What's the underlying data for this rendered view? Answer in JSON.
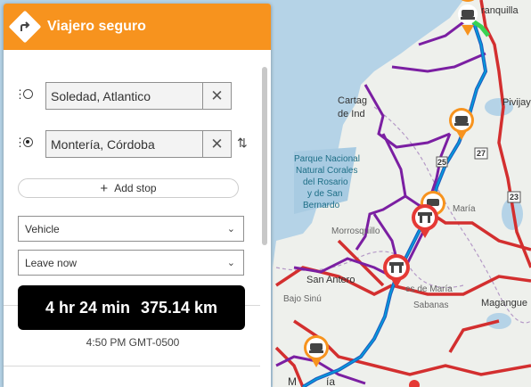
{
  "app": {
    "title": "Viajero seguro"
  },
  "route": {
    "origin": "Soledad, Atlantico",
    "destination": "Montería, Córdoba",
    "add_stop_label": "Add stop",
    "vehicle_select": "Vehicle",
    "departure_select": "Leave now"
  },
  "summary": {
    "duration": "4 hr 24 min",
    "distance": "375.14 km",
    "eta": "4:50 PM GMT-0500"
  },
  "map": {
    "labels": {
      "cartagena_1": "Cartag",
      "cartagena_2": "de Ind",
      "park_1": "Parque Nacional",
      "park_2": "Natural Corales",
      "park_3": "del Rosario",
      "park_4": "y de San",
      "park_5": "Bernardo",
      "pivijay": "Pivijay",
      "barranquilla": "ranquilla",
      "marialabaja": "María",
      "morrosquillo": "Morrosquillo",
      "san_antero": "San Antero",
      "sinu": "Bajo Sinú",
      "montes_maria": "es de María",
      "sabanas": "Sabanas",
      "magangue": "Magangue",
      "monteria_m": "M",
      "monteria_a": "ía",
      "route_27": "27",
      "route_25": "25",
      "route_23": "23"
    },
    "colors": {
      "panel_header": "#f7931e",
      "route_primary": "#1f5fbf",
      "route_alt": "#7b1fa2",
      "road_major": "#d32f2f",
      "marker_orange": "#f7931e",
      "marker_red": "#e53935",
      "sea": "#b5d3e7",
      "land": "#eef0ec"
    }
  }
}
